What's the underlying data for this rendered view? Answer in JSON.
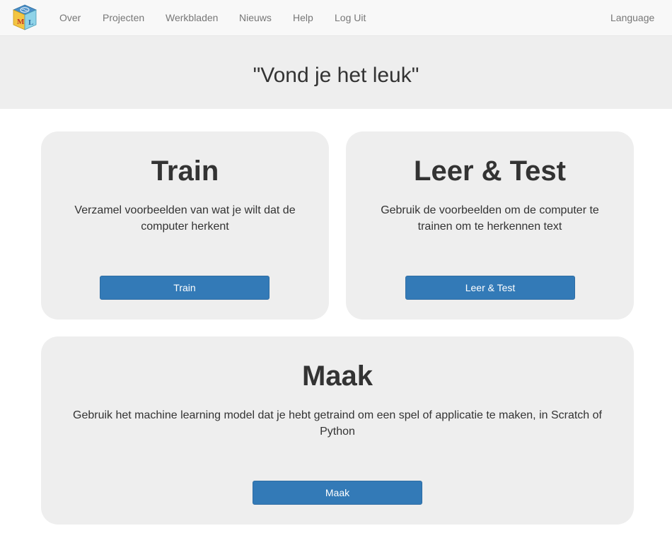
{
  "nav": {
    "items": [
      {
        "label": "Over"
      },
      {
        "label": "Projecten"
      },
      {
        "label": "Werkbladen"
      },
      {
        "label": "Nieuws"
      },
      {
        "label": "Help"
      },
      {
        "label": "Log Uit"
      }
    ],
    "language_label": "Language",
    "logo": {
      "letters": [
        "M",
        "L"
      ],
      "icon": "brain-cube-logo"
    }
  },
  "header": {
    "title": "\"Vond je het leuk\""
  },
  "cards": {
    "train": {
      "title": "Train",
      "description": "Verzamel voorbeelden van wat je wilt dat de computer herkent",
      "button": "Train"
    },
    "learn_test": {
      "title": "Leer & Test",
      "description": "Gebruik de voorbeelden om de computer te trainen om te herkennen text",
      "button": "Leer & Test"
    },
    "make": {
      "title": "Maak",
      "description": "Gebruik het machine learning model dat je hebt getraind om een spel of applicatie te maken, in Scratch of Python",
      "button": "Maak"
    }
  },
  "colors": {
    "primary_button": "#337ab7",
    "card_background": "#eeeeee",
    "navbar_background": "#f8f8f8"
  }
}
